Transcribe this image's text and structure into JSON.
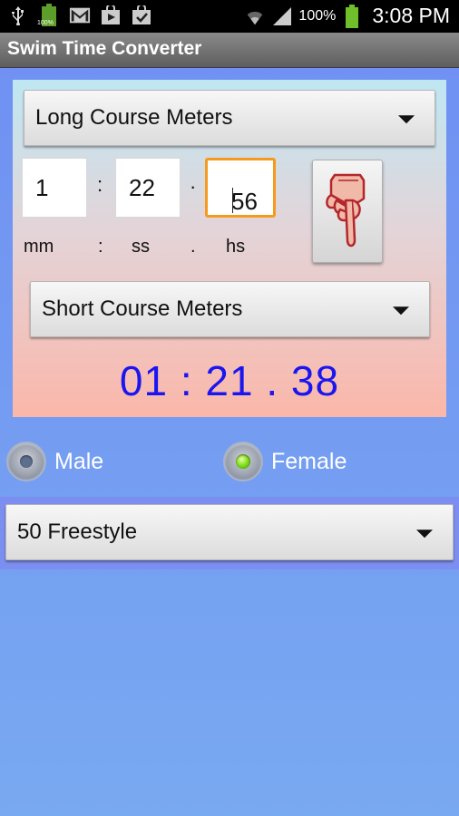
{
  "status_bar": {
    "battery_small": "100%",
    "battery_percent": "100%",
    "time": "3:08 PM"
  },
  "app": {
    "title": "Swim Time Converter"
  },
  "converter": {
    "from_course": "Long Course Meters",
    "minutes": "1",
    "seconds": "22",
    "hundredths": "56",
    "colon_sep": ":",
    "dot_sep": "·",
    "unit_labels": {
      "mm": "mm",
      "colon": ":",
      "ss": "ss",
      "dot": ".",
      "hs": "hs"
    },
    "to_course": "Short Course Meters",
    "result": "01 : 21 . 38"
  },
  "gender": {
    "male_label": "Male",
    "female_label": "Female",
    "selected": "Female"
  },
  "event": {
    "selected": "50 Freestyle"
  },
  "colors": {
    "accent_focus": "#f59a1d",
    "result_text": "#1b16f0",
    "background": "#7b9cf2"
  }
}
